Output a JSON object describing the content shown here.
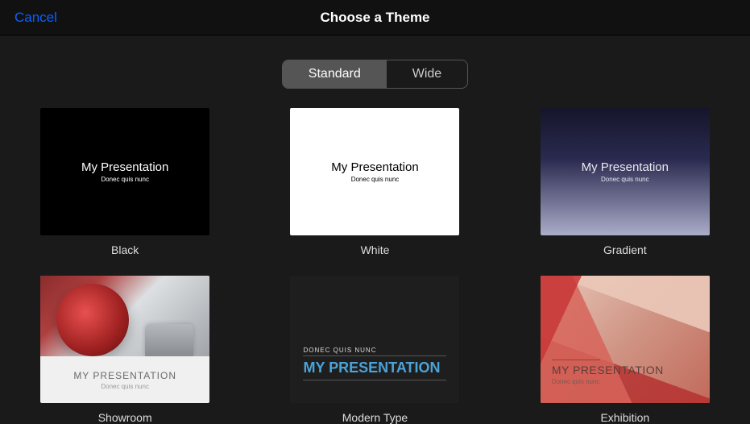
{
  "header": {
    "cancel": "Cancel",
    "title": "Choose a Theme"
  },
  "aspect_ratio_segments": {
    "standard": "Standard",
    "wide": "Wide",
    "selected": "standard"
  },
  "sample": {
    "title": "My Presentation",
    "title_upper": "MY PRESENTATION",
    "subtitle": "Donec quis nunc",
    "subtitle_upper": "DONEC QUIS NUNC"
  },
  "themes": [
    {
      "id": "black",
      "label": "Black"
    },
    {
      "id": "white",
      "label": "White"
    },
    {
      "id": "gradient",
      "label": "Gradient"
    },
    {
      "id": "showroom",
      "label": "Showroom"
    },
    {
      "id": "modern-type",
      "label": "Modern Type"
    },
    {
      "id": "exhibition",
      "label": "Exhibition"
    }
  ]
}
